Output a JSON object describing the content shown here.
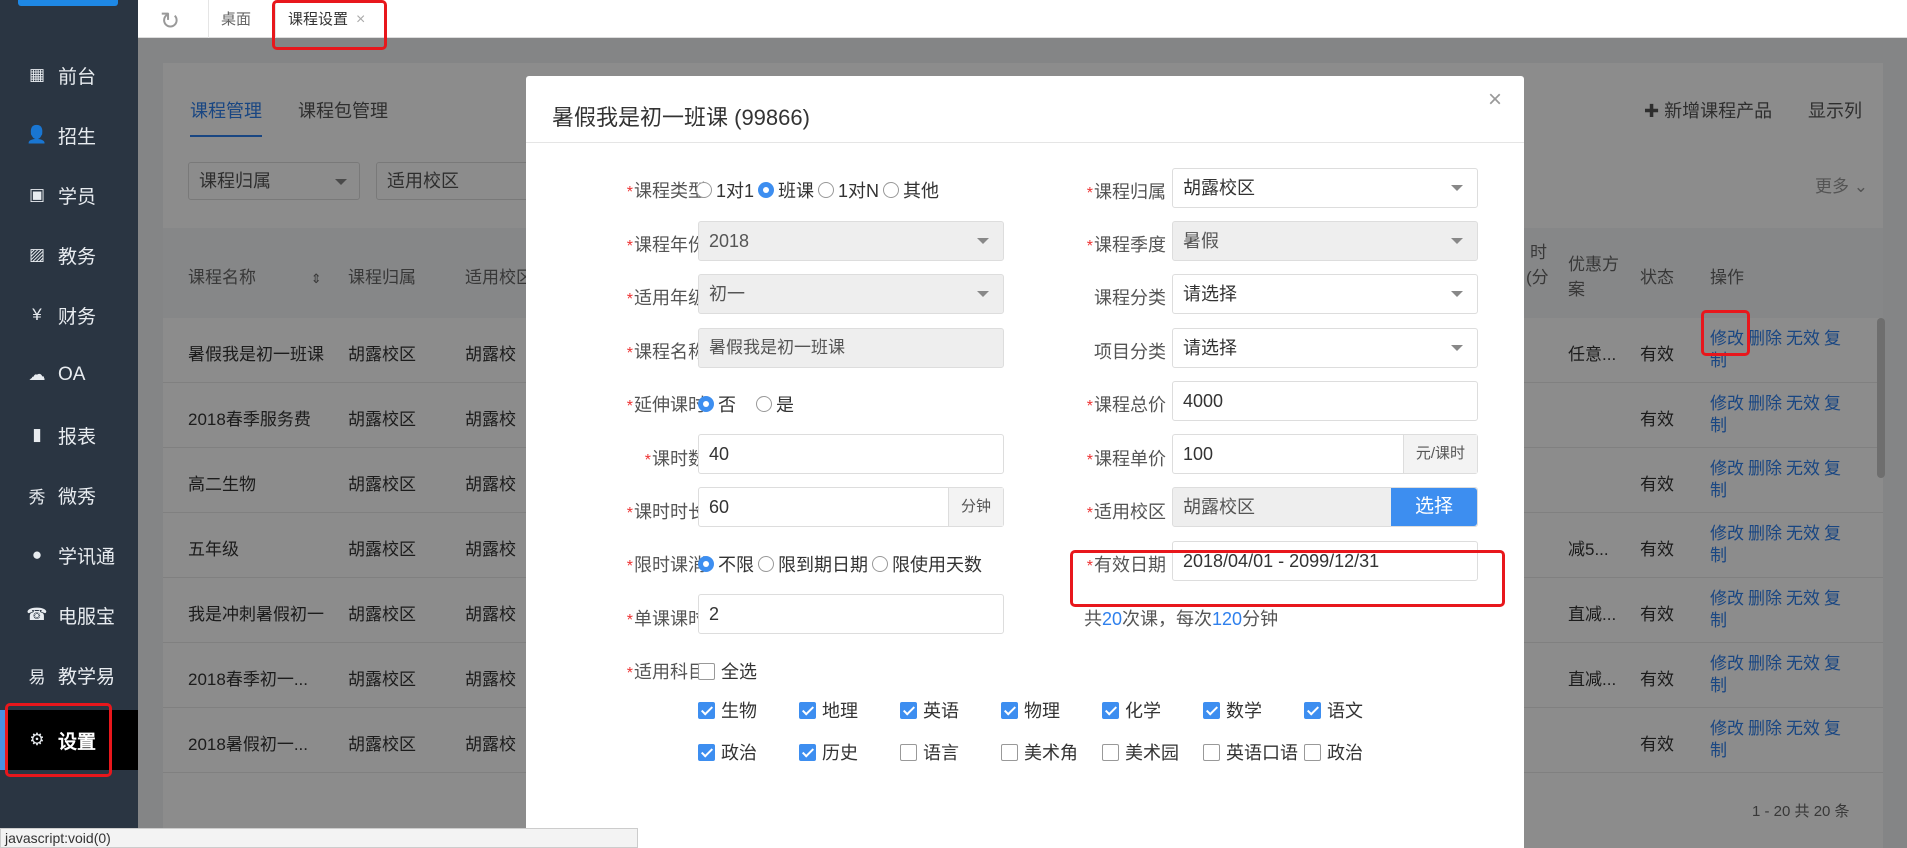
{
  "sidebar": {
    "items": [
      {
        "label": "前台",
        "icon": "calendar-icon"
      },
      {
        "label": "招生",
        "icon": "user-add-icon"
      },
      {
        "label": "学员",
        "icon": "id-card-icon"
      },
      {
        "label": "教务",
        "icon": "image-icon"
      },
      {
        "label": "财务",
        "icon": "yen-icon"
      },
      {
        "label": "OA",
        "icon": "cloud-icon"
      },
      {
        "label": "报表",
        "icon": "bar-chart-icon"
      },
      {
        "label": "微秀",
        "icon": "xiu-icon"
      },
      {
        "label": "学讯通",
        "icon": "location-icon"
      },
      {
        "label": "电服宝",
        "icon": "phone-icon"
      },
      {
        "label": "教学易",
        "icon": "book-icon"
      },
      {
        "label": "设置",
        "icon": "gear-icon"
      }
    ]
  },
  "topbar": {
    "tabs": [
      {
        "label": "桌面"
      },
      {
        "label": "课程设置",
        "close": "×"
      }
    ]
  },
  "content": {
    "tabs": [
      "课程管理",
      "课程包管理"
    ],
    "filters": [
      "课程归属",
      "适用校区"
    ],
    "add_label": "新增课程产品",
    "show_cols": "显示列",
    "more": "更多",
    "headers": [
      "课程名称",
      "课程归属",
      "适用校区",
      "时",
      "(分",
      "优惠方",
      "案",
      "状态",
      "操作"
    ],
    "rows": [
      {
        "name": "暑假我是初一班课",
        "belong": "胡露校区",
        "campus": "胡露校",
        "discount": "任意...",
        "status": "有效"
      },
      {
        "name": "2018春季服务费",
        "belong": "胡露校区",
        "campus": "胡露校",
        "discount": "",
        "status": "有效"
      },
      {
        "name": "高二生物",
        "belong": "胡露校区",
        "campus": "胡露校",
        "discount": "",
        "status": "有效"
      },
      {
        "name": "五年级",
        "belong": "胡露校区",
        "campus": "胡露校",
        "discount": "减5...",
        "status": "有效"
      },
      {
        "name": "我是冲刺暑假初一",
        "belong": "胡露校区",
        "campus": "胡露校",
        "discount": "直减...",
        "status": "有效"
      },
      {
        "name": "2018春季初一...",
        "belong": "胡露校区",
        "campus": "胡露校",
        "discount": "直减...",
        "status": "有效"
      },
      {
        "name": "2018暑假初一...",
        "belong": "胡露校区",
        "campus": "胡露校",
        "discount": "",
        "status": "有效"
      }
    ],
    "ops": {
      "edit": "修改",
      "delete": "删除",
      "invalid": "无效",
      "copy": "复",
      "copy2": "制"
    },
    "pager": "1 - 20   共 20 条"
  },
  "statusbar": "javascript:void(0)",
  "modal": {
    "title": "暑假我是初一班课  (99866)",
    "close": "×",
    "required_mark": "*",
    "course_type": {
      "label": "课程类型",
      "options": [
        "1对1",
        "班课",
        "1对N",
        "其他"
      ],
      "selected": "班课"
    },
    "course_belong": {
      "label": "课程归属",
      "value": "胡露校区"
    },
    "course_year": {
      "label": "课程年份",
      "value": "2018"
    },
    "course_season": {
      "label": "课程季度",
      "value": "暑假"
    },
    "grade": {
      "label": "适用年级",
      "value": "初一"
    },
    "category": {
      "label": "课程分类",
      "value": "请选择"
    },
    "course_name": {
      "label": "课程名称",
      "value": "暑假我是初一班课"
    },
    "project": {
      "label": "项目分类",
      "value": "请选择"
    },
    "extend": {
      "label": "延伸课时",
      "options": [
        "否",
        "是"
      ],
      "selected": "否"
    },
    "total_price": {
      "label": "课程总价",
      "value": "4000"
    },
    "lessons": {
      "label": "课时数",
      "value": "40"
    },
    "unit_price": {
      "label": "课程单价",
      "value": "100",
      "unit": "元/课时"
    },
    "duration": {
      "label": "课时时长",
      "value": "60",
      "unit": "分钟"
    },
    "campus": {
      "label": "适用校区",
      "value": "胡露校区",
      "button": "选择"
    },
    "limit": {
      "label": "限时课消",
      "options": [
        "不限",
        "限到期日期",
        "限使用天数"
      ],
      "selected": "不限"
    },
    "valid": {
      "label": "有效日期",
      "value": "2018/04/01 - 2099/12/31"
    },
    "single": {
      "label": "单课课时",
      "value": "2"
    },
    "summary": {
      "p1": "共",
      "n1": "20",
      "p2": "次课，每次",
      "n2": "120",
      "p3": "分钟"
    },
    "subjects": {
      "label": "适用科目",
      "all": "全选",
      "row1": [
        "生物",
        "地理",
        "英语",
        "物理",
        "化学",
        "数学",
        "语文"
      ],
      "row2": [
        "政治",
        "历史",
        "语言",
        "美术角",
        "美术园",
        "英语口语",
        "政治"
      ]
    }
  }
}
